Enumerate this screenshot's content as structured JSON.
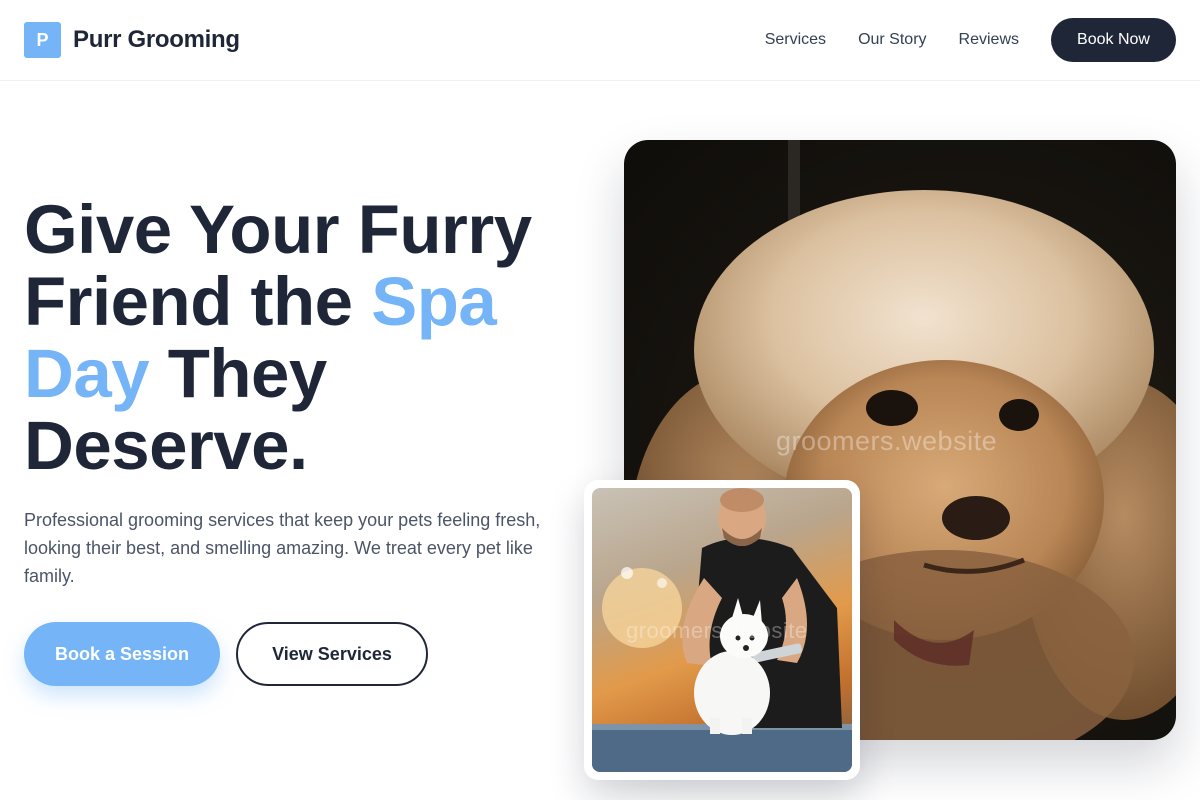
{
  "brand": {
    "mark": "P",
    "name": "Purr Grooming",
    "accent_color": "#74b4f7",
    "dark_color": "#1e2638"
  },
  "nav": {
    "links": [
      "Services",
      "Our Story",
      "Reviews"
    ],
    "cta": "Book Now"
  },
  "hero": {
    "headline_line1": "Give Your Furry",
    "headline_line2_pre": "Friend the ",
    "headline_line2_accent": "Spa",
    "headline_line3_accent": "Day",
    "headline_line3_post": " They",
    "headline_line4": "Deserve.",
    "subtext": "Professional grooming services that keep your pets feeling fresh, looking their best, and smelling amazing. We treat every pet like family.",
    "primary_button": "Book a Session",
    "secondary_button": "View Services"
  },
  "images": {
    "main_watermark": "groomers.website",
    "inset_watermark": "groomers.website"
  }
}
